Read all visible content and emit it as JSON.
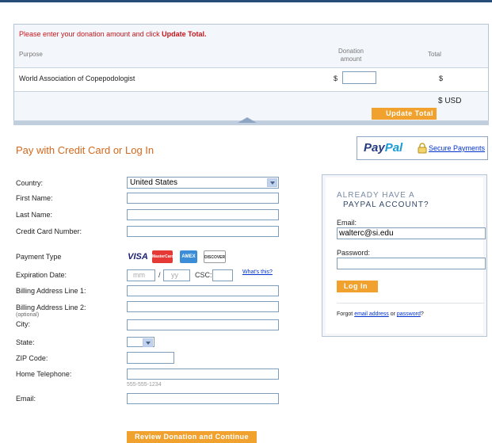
{
  "donation": {
    "notice_prefix": "Please enter your donation amount and click ",
    "notice_bold": "Update Total.",
    "col_purpose": "Purpose",
    "col_amount": "Donation amount",
    "col_total": "Total",
    "org_name": "World Association of Copepodologist",
    "amount_currency": "$",
    "amount_value": "",
    "total_currency": "$",
    "grand_total": "$ USD",
    "update_button": "Update Total"
  },
  "heading": "Pay with Credit Card or Log In",
  "paypal": {
    "logo_pay": "Pay",
    "logo_pal": "Pal",
    "secure_link": "Secure Payments"
  },
  "form": {
    "country_label": "Country:",
    "country_value": "United States",
    "first_name_label": "First Name:",
    "last_name_label": "Last Name:",
    "card_number_label": "Credit Card Number:",
    "payment_type_label": "Payment Type",
    "cards": [
      "VISA",
      "MasterCard",
      "AMEX",
      "DISCOVER"
    ],
    "expiration_label": "Expiration Date:",
    "exp_mm_placeholder": "mm",
    "exp_separator": "/",
    "exp_yy_placeholder": "yy",
    "csc_label": "CSC:",
    "whats_this": "What's this?",
    "billing1_label": "Billing Address Line 1:",
    "billing2_label": "Billing Address Line 2:",
    "billing2_sub": "(optional)",
    "city_label": "City:",
    "state_label": "State:",
    "zip_label": "ZIP Code:",
    "phone_label": "Home Telephone:",
    "phone_hint": "555-555-1234",
    "email_label": "Email:",
    "review_button": "Review Donation and Continue"
  },
  "login": {
    "already_line1": "ALREADY HAVE A",
    "already_line2": "PAYPAL ACCOUNT?",
    "email_label": "Email:",
    "email_value": "walterc@si.edu",
    "password_label": "Password:",
    "login_button": "Log In",
    "forgot_prefix": "Forgot ",
    "forgot_email": "email address",
    "forgot_or": " or ",
    "forgot_password": "password",
    "forgot_suffix": "?"
  }
}
